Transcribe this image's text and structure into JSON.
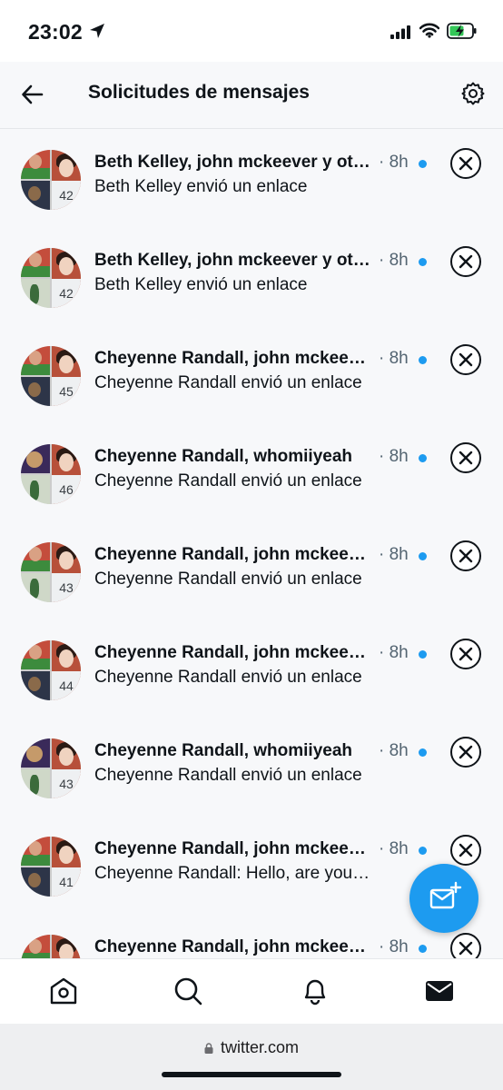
{
  "status_bar": {
    "time": "23:02"
  },
  "header": {
    "title": "Solicitudes de mensajes"
  },
  "requests": [
    {
      "name": "Beth Kelley, john mckeever y otros",
      "time": "· 8h",
      "preview": "Beth Kelley envió un enlace",
      "count": "42",
      "avatar_bl": "dark"
    },
    {
      "name": "Beth Kelley, john mckeever y otros",
      "time": "· 8h",
      "preview": "Beth Kelley envió un enlace",
      "count": "42",
      "avatar_bl": "green"
    },
    {
      "name": "Cheyenne Randall, john mckeever",
      "time": "· 8h",
      "preview": "Cheyenne Randall envió un enlace",
      "count": "45",
      "avatar_bl": "dark"
    },
    {
      "name": "Cheyenne Randall, whomiiyeah",
      "time": "· 8h",
      "preview": "Cheyenne Randall envió un enlace",
      "count": "46",
      "avatar_bl": "green"
    },
    {
      "name": "Cheyenne Randall, john mckeever",
      "time": "· 8h",
      "preview": "Cheyenne Randall envió un enlace",
      "count": "43",
      "avatar_bl": "green"
    },
    {
      "name": "Cheyenne Randall, john mckeever",
      "time": "· 8h",
      "preview": "Cheyenne Randall envió un enlace",
      "count": "44",
      "avatar_bl": "dark"
    },
    {
      "name": "Cheyenne Randall, whomiiyeah",
      "time": "· 8h",
      "preview": "Cheyenne Randall envió un enlace",
      "count": "43",
      "avatar_bl": "green"
    },
    {
      "name": "Cheyenne Randall, john mckeever",
      "time": "· 8h",
      "preview": "Cheyenne Randall: Hello, are you there",
      "count": "41",
      "avatar_bl": "dark"
    },
    {
      "name": "Cheyenne Randall, john mckeever",
      "time": "· 8h",
      "preview": "",
      "count": "",
      "avatar_bl": "dark"
    }
  ],
  "browser": {
    "url": "twitter.com"
  },
  "colors": {
    "accent": "#1d9bf0",
    "text": "#0f1419",
    "secondary_text": "#536471",
    "background": "#f7f8fa"
  },
  "icons": {
    "back": "arrow-left-icon",
    "settings": "gear-icon",
    "close": "close-circle-icon",
    "compose": "new-message-icon",
    "home": "home-icon",
    "search": "search-icon",
    "notifications": "bell-icon",
    "messages": "envelope-icon"
  }
}
